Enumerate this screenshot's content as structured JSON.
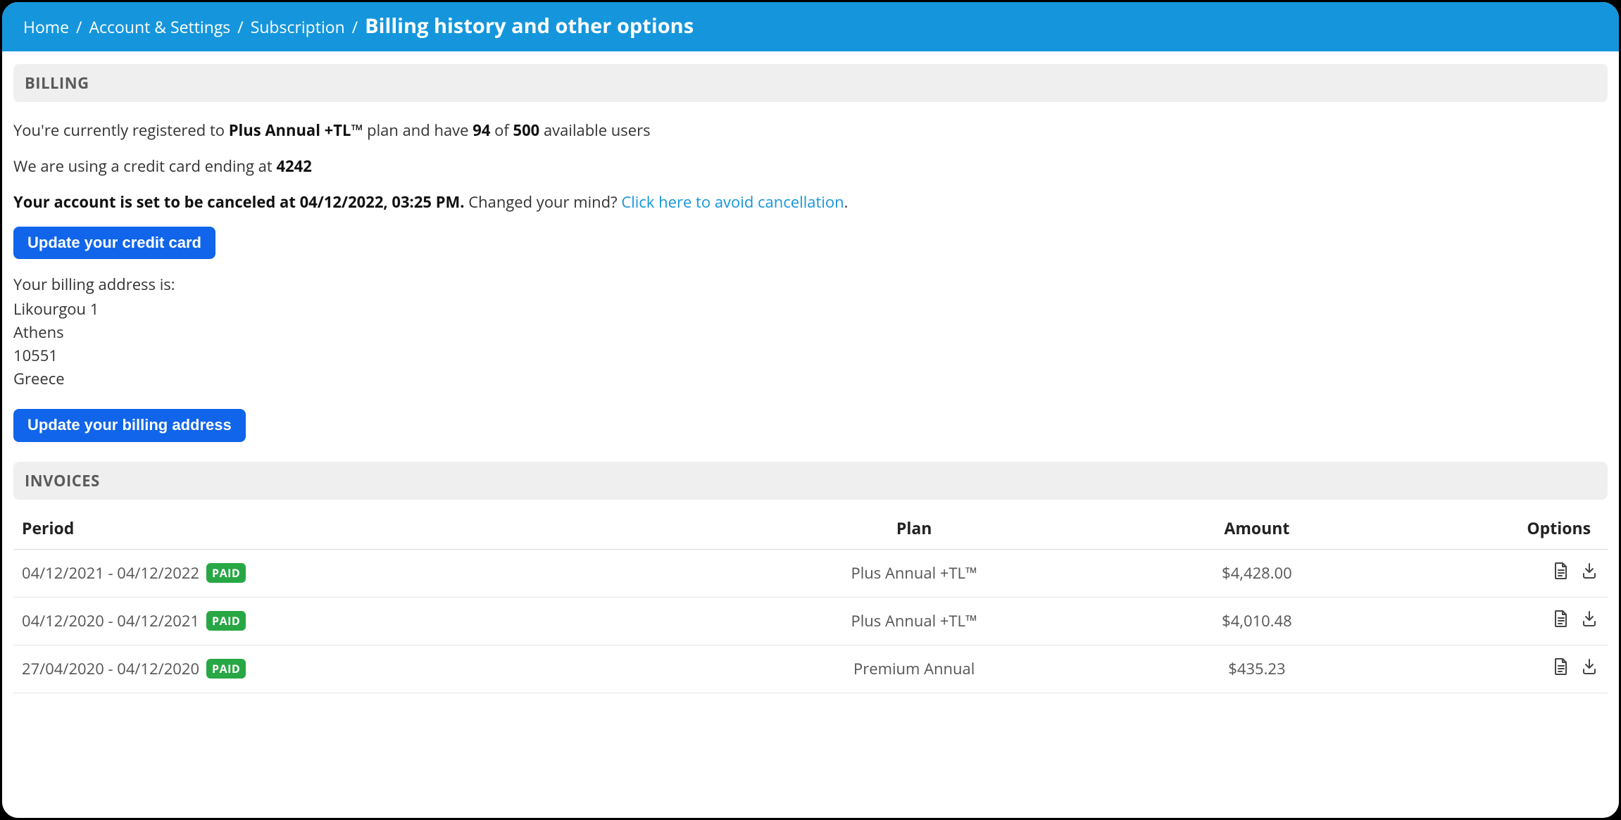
{
  "breadcrumb": {
    "items": [
      {
        "label": "Home"
      },
      {
        "label": "Account & Settings"
      },
      {
        "label": "Subscription"
      }
    ],
    "current": "Billing history and other options",
    "separator": "/"
  },
  "sections": {
    "billing_header": "BILLING",
    "invoices_header": "INVOICES"
  },
  "billing": {
    "plan_sentence_prefix": "You're currently registered to ",
    "plan_name": "Plus Annual +TL™",
    "plan_sentence_mid": " plan and have ",
    "users_used": "94",
    "plan_sentence_of": " of ",
    "users_total": "500",
    "plan_sentence_suffix": " available users",
    "card_sentence_prefix": "We are using a credit card ending at ",
    "card_last4": "4242",
    "cancel_notice_prefix": "Your account is set to be canceled at ",
    "cancel_datetime": "04/12/2022, 03:25 PM",
    "cancel_notice_period": ".",
    "changed_mind_text": " Changed your mind? ",
    "avoid_cancel_link": "Click here to avoid cancellation",
    "trailing_period": "."
  },
  "buttons": {
    "update_card": "Update your credit card",
    "update_billing_address": "Update your billing address"
  },
  "billing_address": {
    "label": "Your billing address is:",
    "line1": "Likourgou 1",
    "city": "Athens",
    "postal": "10551",
    "country": "Greece"
  },
  "invoices": {
    "columns": {
      "period": "Period",
      "plan": "Plan",
      "amount": "Amount",
      "options": "Options"
    },
    "paid_badge": "PAID",
    "rows": [
      {
        "period": "04/12/2021 - 04/12/2022",
        "status": "PAID",
        "plan": "Plus Annual +TL™",
        "amount": "$4,428.00"
      },
      {
        "period": "04/12/2020 - 04/12/2021",
        "status": "PAID",
        "plan": "Plus Annual +TL™",
        "amount": "$4,010.48"
      },
      {
        "period": "27/04/2020 - 04/12/2020",
        "status": "PAID",
        "plan": "Premium Annual",
        "amount": "$435.23"
      }
    ]
  },
  "icons": {
    "view_invoice": "document-icon",
    "download_invoice": "download-icon"
  }
}
